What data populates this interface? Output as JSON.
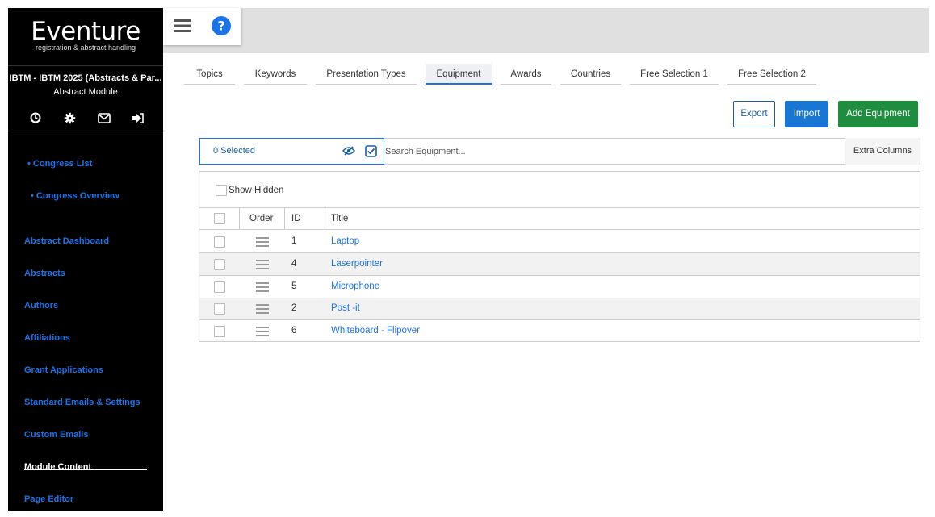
{
  "sidebar": {
    "logo_main": "Eventure",
    "logo_sub": "registration & abstract handling",
    "congress_name": "IBTM - IBTM 2025 (Abstracts & Par...",
    "module_name": "Abstract Module",
    "icons": [
      "clock-icon",
      "gear-icon",
      "mail-icon",
      "logout-icon"
    ],
    "sub_items": [
      "• Congress List",
      "• Congress Overview"
    ],
    "items": [
      "Abstract Dashboard",
      "Abstracts",
      "Authors",
      "Affiliations",
      "Grant Applications",
      "Standard Emails & Settings",
      "Custom Emails",
      "Module Content",
      "Page Editor"
    ],
    "active_item": "Module Content"
  },
  "topbar": {
    "icons": [
      "hamburger-icon",
      "help-icon"
    ],
    "accent_color": "#1a73e8"
  },
  "tabs": [
    {
      "label": "Topics"
    },
    {
      "label": "Keywords"
    },
    {
      "label": "Presentation Types"
    },
    {
      "label": "Equipment",
      "active": true
    },
    {
      "label": "Awards"
    },
    {
      "label": "Countries"
    },
    {
      "label": "Free Selection 1"
    },
    {
      "label": "Free Selection 2"
    }
  ],
  "actions": {
    "export_label": "Export",
    "import_label": "Import",
    "add_label": "Add Equipment",
    "export_color": "#1a5f9e",
    "import_color": "#1976d2",
    "add_color": "#1e8e3e"
  },
  "search": {
    "selected_text": "0 Selected",
    "placeholder": "Search Equipment...",
    "extra_columns_label": "Extra Columns"
  },
  "table": {
    "show_hidden_label": "Show Hidden",
    "headers": {
      "order": "Order",
      "id": "ID",
      "title": "Title"
    },
    "rows": [
      {
        "id": "1",
        "title": "Laptop"
      },
      {
        "id": "4",
        "title": "Laserpointer"
      },
      {
        "id": "5",
        "title": "Microphone"
      },
      {
        "id": "2",
        "title": "Post -it"
      },
      {
        "id": "6",
        "title": "Whiteboard - Flipover"
      }
    ]
  }
}
